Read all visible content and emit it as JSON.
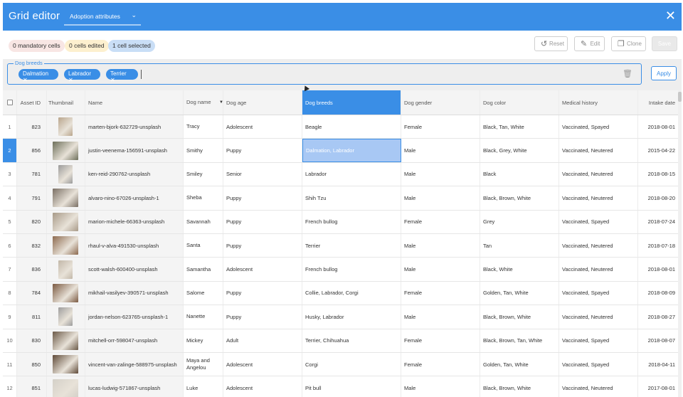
{
  "header": {
    "title": "Grid editor",
    "tab_label": "Adoption attributes",
    "close_label": "✕"
  },
  "status": {
    "mandatory": "0 mandatory cells",
    "edited": "0 cells edited",
    "selected": "1 cell selected"
  },
  "toolbar": {
    "reset": "Reset",
    "edit": "Edit",
    "clone": "Clone",
    "save": "Save"
  },
  "filter": {
    "legend": "Dog breeds",
    "chips": [
      "Dalmation",
      "Labrador",
      "Terrier"
    ],
    "apply": "Apply"
  },
  "columns": {
    "asset_id": "Asset ID",
    "thumbnail": "Thumbnail",
    "name": "Name",
    "dog_name": "Dog name",
    "dog_age": "Dog age",
    "dog_breeds": "Dog breeds",
    "dog_gender": "Dog gender",
    "dog_color": "Dog color",
    "medical": "Medical history",
    "intake": "Intake date"
  },
  "rows": [
    {
      "n": "1",
      "id": "823",
      "file": "marten-bjork-632729-unsplash",
      "dname": "Tracy",
      "age": "Adolescent",
      "breed": "Beagle",
      "gender": "Female",
      "color": "Black, Tan, White",
      "med": "Vaccinated, Spayed",
      "date": "2018-08-01"
    },
    {
      "n": "2",
      "id": "856",
      "file": "justin-veenema-156591-unsplash",
      "dname": "Smithy",
      "age": "Puppy",
      "breed": "Dalmation, Labrador",
      "gender": "Male",
      "color": "Black, Grey, White",
      "med": "Vaccinated, Neutered",
      "date": "2015-04-22"
    },
    {
      "n": "3",
      "id": "781",
      "file": "ken-reid-290762-unsplash",
      "dname": "Smiley",
      "age": "Senior",
      "breed": "Labrador",
      "gender": "Male",
      "color": "Black",
      "med": "Vaccinated, Neutered",
      "date": "2018-08-15"
    },
    {
      "n": "4",
      "id": "791",
      "file": "alvaro-nino-67026-unsplash-1",
      "dname": "Sheba",
      "age": "Puppy",
      "breed": "Shih Tzu",
      "gender": "Male",
      "color": "Black, Brown, White",
      "med": "Vaccinated, Neutered",
      "date": "2018-08-20"
    },
    {
      "n": "5",
      "id": "820",
      "file": "marion-michele-66363-unsplash",
      "dname": "Savannah",
      "age": "Puppy",
      "breed": "French bullog",
      "gender": "Female",
      "color": "Grey",
      "med": "Vaccinated, Spayed",
      "date": "2018-07-24"
    },
    {
      "n": "6",
      "id": "832",
      "file": "rhaul-v-alva-491530-unsplash",
      "dname": "Santa",
      "age": "Puppy",
      "breed": "Terrier",
      "gender": "Male",
      "color": "Tan",
      "med": "Vaccinated, Neutered",
      "date": "2018-07-18"
    },
    {
      "n": "7",
      "id": "836",
      "file": "scott-walsh-600400-unsplash",
      "dname": "Samantha",
      "age": "Adolescent",
      "breed": "French bullog",
      "gender": "Male",
      "color": "Black, White",
      "med": "Vaccinated, Neutered",
      "date": "2018-08-01"
    },
    {
      "n": "8",
      "id": "784",
      "file": "mikhail-vasilyev-390571-unsplash",
      "dname": "Salome",
      "age": "Puppy",
      "breed": "Collie, Labrador, Corgi",
      "gender": "Female",
      "color": "Golden, Tan, White",
      "med": "Vaccinated, Spayed",
      "date": "2018-08-09"
    },
    {
      "n": "9",
      "id": "811",
      "file": "jordan-nelson-623765-unsplash-1",
      "dname": "Nanette",
      "age": "Puppy",
      "breed": "Husky, Labrador",
      "gender": "Male",
      "color": "Black, Brown, White",
      "med": "Vaccinated, Neutered",
      "date": "2018-08-27"
    },
    {
      "n": "10",
      "id": "830",
      "file": "mitchell-orr-598047-unsplash",
      "dname": "Mickey",
      "age": "Adult",
      "breed": "Terrier, Chihuahua",
      "gender": "Female",
      "color": "Black, Brown, Tan, White",
      "med": "Vaccinated, Spayed",
      "date": "2018-08-07"
    },
    {
      "n": "11",
      "id": "850",
      "file": "vincent-van-zalinge-588975-unsplash",
      "dname": "Maya and Angelou",
      "age": "Adolescent",
      "breed": "Corgi",
      "gender": "Female",
      "color": "Golden, Tan, White",
      "med": "Vaccinated, Spayed",
      "date": "2018-04-11"
    },
    {
      "n": "12",
      "id": "851",
      "file": "lucas-ludwig-571867-unsplash",
      "dname": "Luke",
      "age": "Adolescent",
      "breed": "Pit bull",
      "gender": "Male",
      "color": "Black, Brown, White",
      "med": "Vaccinated, Neutered",
      "date": "2017-08-01"
    }
  ],
  "thumb_colors": [
    "#b9a58c",
    "#6d6f5a",
    "#9a9a9a",
    "#7a6f64",
    "#a89a88",
    "#8d6a4f",
    "#c2b7a8",
    "#7b5a42",
    "#9c9c9c",
    "#6c5a48",
    "#5f4a38",
    "#d4d0c8"
  ],
  "colors": {
    "accent": "#3a8ee6",
    "selected_cell": "#a8c8f4"
  }
}
